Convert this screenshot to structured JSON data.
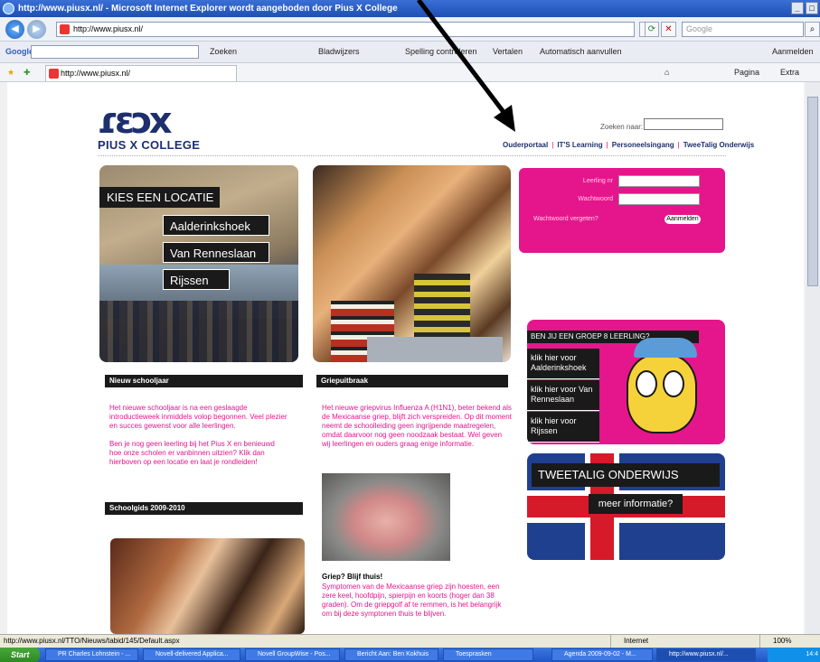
{
  "window": {
    "title": "http://www.piusx.nl/ - Microsoft Internet Explorer wordt aangeboden door Pius X College"
  },
  "addressbar": {
    "url": "http://www.piusx.nl/",
    "search_placeholder": "Google"
  },
  "google_toolbar": {
    "brand": "Google",
    "items": [
      "Zoeken",
      "Bladwijzers",
      "Spelling controleren",
      "Vertalen",
      "Automatisch aanvullen",
      "Aanmelden"
    ]
  },
  "tab": {
    "title": "http://www.piusx.nl/"
  },
  "command_bar": {
    "pagina": "Pagina",
    "extra": "Extra"
  },
  "site": {
    "logo_mark": "ɾɛɔx",
    "logo_text": "PIUS X COLLEGE",
    "search_label": "Zoeken naar:",
    "top_links": [
      "Ouderportaal",
      "IT'S Learning",
      "Personeelsingang",
      "TweeTalig Onderwijs"
    ],
    "locatie": {
      "heading": "KIES EEN LOCATIE",
      "options": [
        "Aalderinkshoek",
        "Van Renneslaan",
        "Rijssen"
      ]
    },
    "login": {
      "user_label": "Leerling nr",
      "pass_label": "Wachtwoord",
      "forgot": "Wachtwoord vergeten?",
      "button": "Aanmelden"
    },
    "groep8": {
      "heading": "BEN JIJ EEN GROEP 8 LEERLING?",
      "items": [
        "klik hier voor Aalderinkshoek",
        "klik hier voor Van Renneslaan",
        "klik hier voor Rijssen"
      ]
    },
    "tto": {
      "title": "TWEETALIG ONDERWIJS",
      "more": "meer informatie?"
    },
    "news1": {
      "title": "Nieuw schooljaar",
      "p1": "Het nieuwe schooljaar is na een geslaagde introductieweek inmiddels volop begonnen. Veel plezier en succes gewenst voor alle leerlingen.",
      "p2": "Ben je nog geen leerling bij het Pius X en benieuwd hoe onze scholen er vanbinnen uitzien? Klik dan hierboven op een locatie en laat je rondleiden!"
    },
    "news2": {
      "title": "Griepuitbraak",
      "p1": "Het nieuwe griepvirus Influenza A (H1N1), beter bekend als de Mexicaanse griep, blijft zich verspreiden. Op dit moment neemt de schoolleiding geen ingrijpende maatregelen, omdat daarvoor nog geen noodzaak bestaat. Wel geven wij leerlingen en ouders graag enige informatie.",
      "h2": "Griep? Blijf thuis!",
      "p2": "Symptomen van de Mexicaanse griep zijn hoesten, een zere keel, hoofdpijn, spierpijn en koorts (hoger dan 38 graden). Om de griepgolf af te remmen, is het belangrijk om bij deze symptonen thuis te blijven."
    },
    "news3": {
      "title": "Schoolgids 2009-2010"
    }
  },
  "statusbar": {
    "url": "http://www.piusx.nl/TTO/Nieuws/tabid/145/Default.aspx",
    "zone": "Internet",
    "zoom": "100%"
  },
  "taskbar": {
    "start": "Start",
    "items": [
      "PR Charles Lohnstein - ...",
      "Novell-delivered Applica...",
      "Novell GroupWise - Pos...",
      "Bericht Aan: Ben Kokhuis",
      "Toesprasken",
      "Agenda 2009-09-02 - M...",
      "http://www.piusx.nl/..."
    ],
    "clock": "14:4"
  }
}
